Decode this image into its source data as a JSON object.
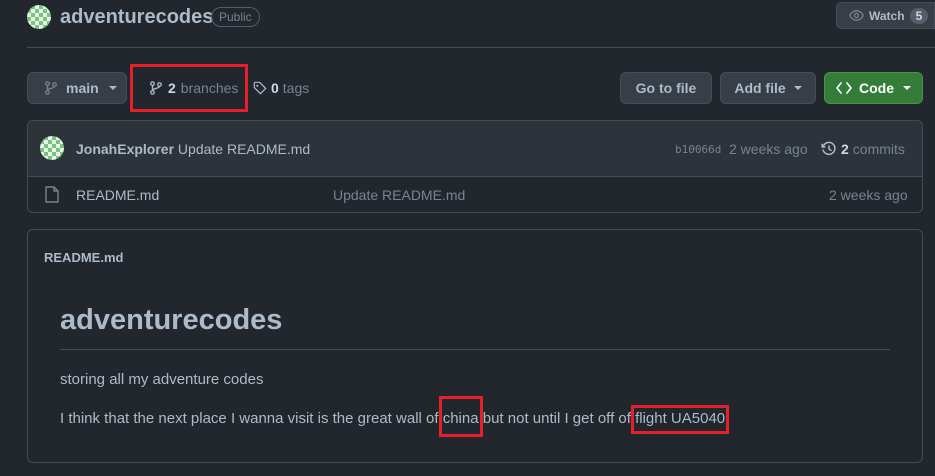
{
  "repo": {
    "name": "adventurecodes",
    "visibility": "Public",
    "watch_label": "Watch",
    "watch_count": "5"
  },
  "toolbar": {
    "branch": "main",
    "branches_count": "2",
    "branches_label": "branches",
    "tags_count": "0",
    "tags_label": "tags",
    "go_to_file": "Go to file",
    "add_file": "Add file",
    "code": "Code"
  },
  "commit": {
    "author": "JonahExplorer",
    "message": "Update README.md",
    "hash": "b10066d",
    "time": "2 weeks ago",
    "commits_count": "2",
    "commits_label": "commits"
  },
  "files": [
    {
      "name": "README.md",
      "message": "Update README.md",
      "time": "2 weeks ago"
    }
  ],
  "readme": {
    "filename": "README.md",
    "heading": "adventurecodes",
    "line1": "storing all my adventure codes",
    "line2_part1": "I think that the next place I wanna visit is the great wall of ",
    "line2_china": "china",
    "line2_part2": " but not until I get off of ",
    "line2_flight": "flight UA5040"
  },
  "colors": {
    "background": "#22272e",
    "code_button": "#347d39",
    "highlight": "#e5202a"
  }
}
